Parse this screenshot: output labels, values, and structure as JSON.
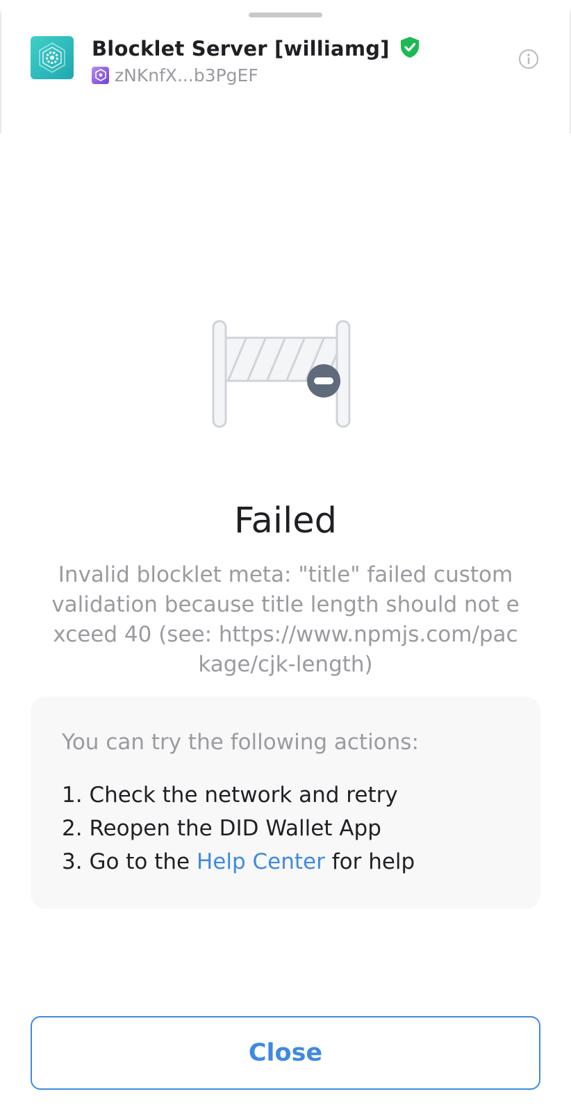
{
  "header": {
    "app_title": "Blocklet Server [williamg]",
    "did_short": "zNKnfX...b3PgEF",
    "logo_icon": "blocklet-hexagon-gear-icon",
    "verified_icon": "verified-shield-icon",
    "info_icon": "info-circle-icon"
  },
  "status": {
    "illustration_icon": "blocked-barrier-icon",
    "title": "Failed",
    "message": "Invalid blocklet meta: \"title\" failed custom validation because title length should not exceed 40 (see: https://www.npmjs.com/package/cjk-length)"
  },
  "actions": {
    "intro": "You can try the following actions:",
    "items": [
      {
        "prefix": "1. ",
        "text": "Check the network and retry"
      },
      {
        "prefix": "2. ",
        "text": "Reopen the DID Wallet App"
      },
      {
        "prefix": "3. ",
        "text_before": "Go to the ",
        "link": "Help Center",
        "text_after": " for help"
      }
    ]
  },
  "footer": {
    "close_label": "Close"
  },
  "colors": {
    "accent": "#3f8ae0",
    "verified_green": "#1db954",
    "logo_teal": "#2bbfbf",
    "muted_text": "#9a9aa0",
    "primary_text": "#1f2024",
    "card_background": "#f8f8f9"
  }
}
